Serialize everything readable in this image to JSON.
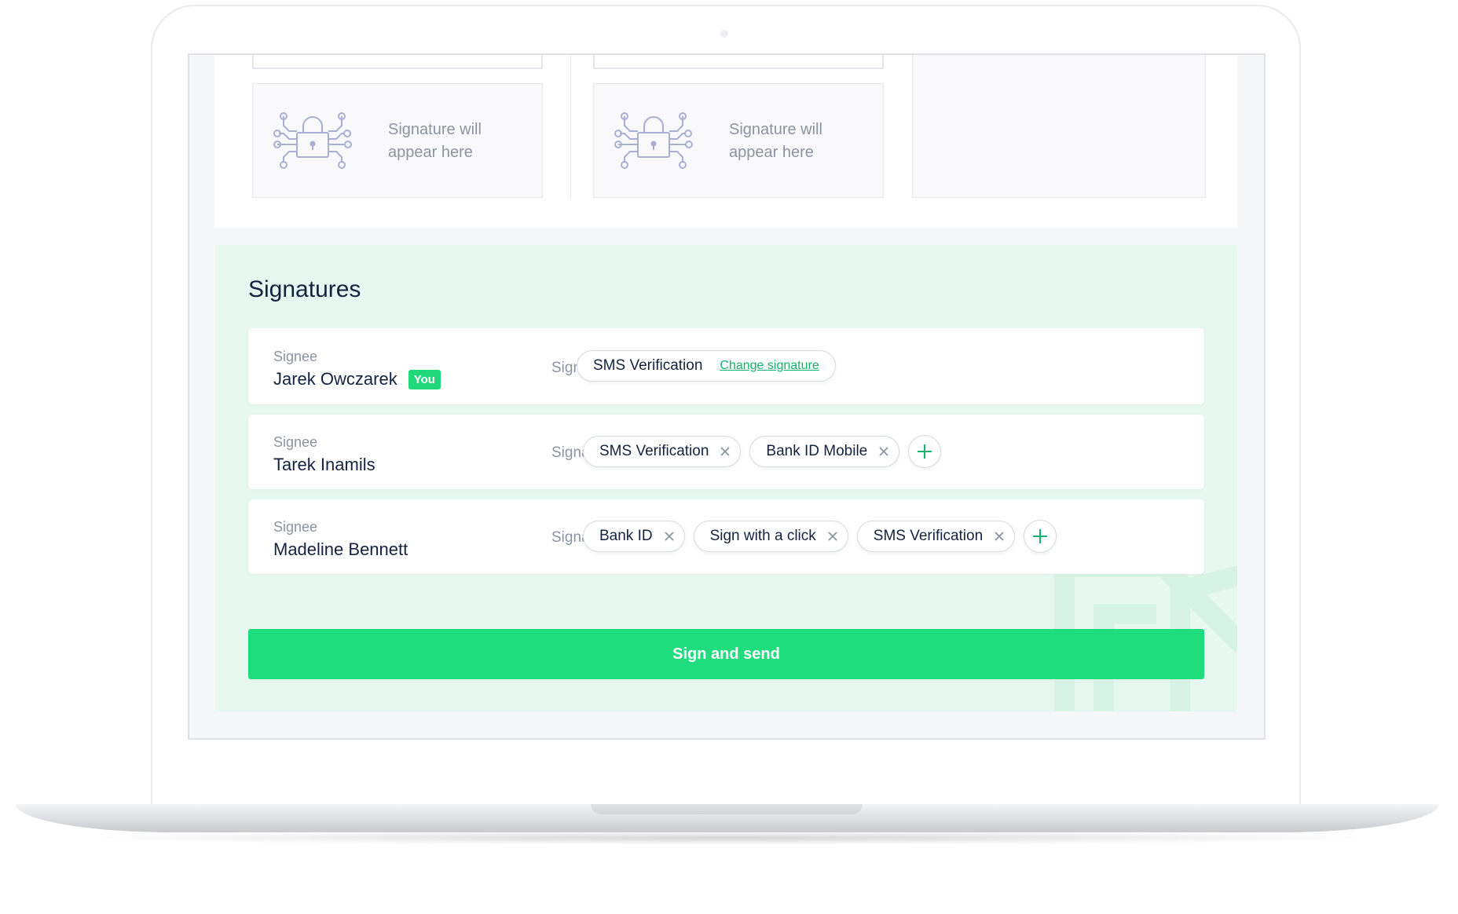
{
  "placeholders": [
    {
      "text_line1": "Signature will",
      "text_line2": "appear here"
    },
    {
      "text_line1": "Signature will",
      "text_line2": "appear here"
    }
  ],
  "panel": {
    "title": "Signatures"
  },
  "signees": [
    {
      "label": "Signee",
      "name": "Jarek Owczarek",
      "badge": "You",
      "signature_label": "Signature",
      "signature": "SMS Verification",
      "change_link": "Change signature"
    },
    {
      "label": "Signee",
      "name": "Tarek Inamils",
      "signature_label": "Signatures",
      "signatures": [
        "SMS Verification",
        "Bank ID Mobile"
      ]
    },
    {
      "label": "Signee",
      "name": "Madeline Bennett",
      "signature_label": "Signatures",
      "signatures": [
        "Bank ID",
        "Sign with a click",
        "SMS Verification"
      ]
    }
  ],
  "actions": {
    "sign_and_send": "Sign and send"
  },
  "icons": {
    "placeholder": "padlock-circuit-icon",
    "remove": "close-icon",
    "add": "plus-icon"
  },
  "colors": {
    "accent": "#1fdc7c",
    "panel_bg": "#e7f8f0",
    "link": "#14b36b",
    "text_dark": "#13233f",
    "text_muted": "#8b93a1"
  }
}
